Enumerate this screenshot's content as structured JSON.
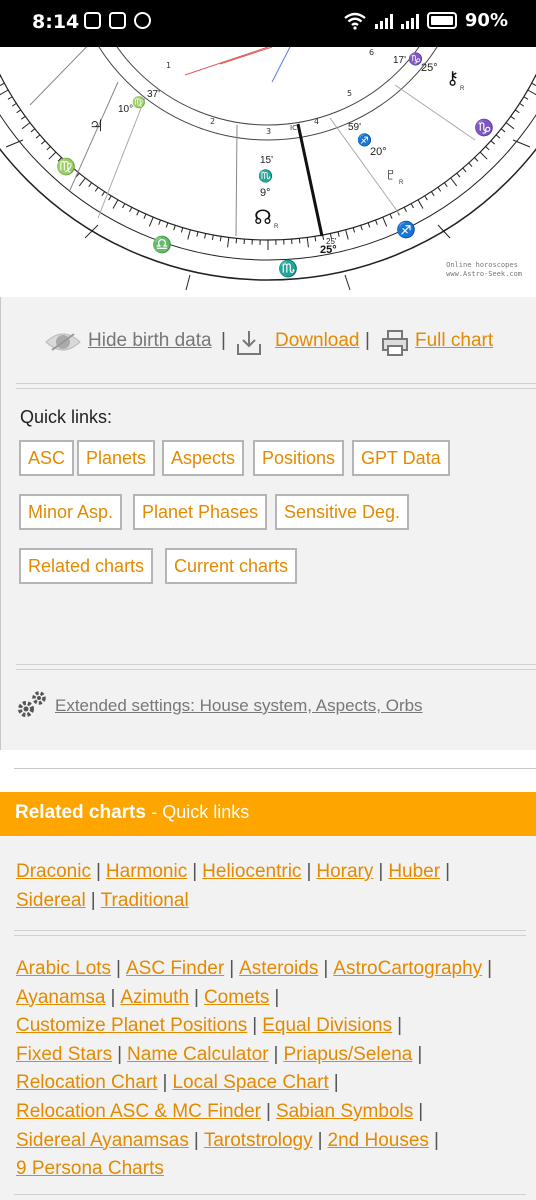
{
  "status_bar": {
    "time": "8:14",
    "battery": "90%"
  },
  "chart": {
    "credit_line1": "Online horoscopes",
    "credit_line2": "www.Astro-Seek.com",
    "labels": {
      "deg_17": "17'",
      "deg_25_top": "25°",
      "deg_37": "37'",
      "deg_10": "10°",
      "deg_59": "59'",
      "deg_20": "20°",
      "deg_15": "15'",
      "deg_9": "9°",
      "deg_25_bottom_min": "25'",
      "deg_25_bottom": "25°",
      "house_1": "1",
      "house_2": "2",
      "house_3": "3",
      "house_4": "4",
      "house_5": "5",
      "house_6": "6",
      "ic": "IC",
      "r": "R"
    }
  },
  "actions": {
    "hide": "Hide birth data",
    "download": "Download",
    "full_chart": "Full chart",
    "separator": "|"
  },
  "quick_links": {
    "title": "Quick links:",
    "buttons": [
      "ASC",
      "Planets",
      "Aspects",
      "Positions",
      "GPT Data",
      "Minor Asp.",
      "Planet Phases",
      "Sensitive Deg.",
      "Related charts",
      "Current charts"
    ]
  },
  "settings": {
    "text": "Extended settings: House system, Aspects, Orbs"
  },
  "related": {
    "title": "Related charts",
    "subtitle": "- Quick links",
    "group1": [
      "Draconic",
      "Harmonic",
      "Heliocentric",
      "Horary",
      "Huber",
      "Sidereal",
      "Traditional"
    ],
    "group2": [
      "Arabic Lots",
      "ASC Finder",
      "Asteroids",
      "AstroCartography",
      "Ayanamsa",
      "Azimuth",
      "Comets",
      "Customize Planet Positions",
      "Equal Divisions",
      "Fixed Stars",
      "Name Calculator",
      "Priapus/Selena",
      "Relocation Chart",
      "Local Space Chart",
      "Relocation ASC & MC Finder",
      "Sabian Symbols",
      "Sidereal Ayanamsas",
      "Tarotstrology",
      "2nd Houses",
      "9 Persona Charts"
    ]
  },
  "colors": {
    "accent": "#e38a00",
    "bar": "#ffa500",
    "fire": "#d32f2f",
    "water": "#1a3fb0",
    "earth": "#2e9b2e",
    "air": "#d08a00"
  }
}
